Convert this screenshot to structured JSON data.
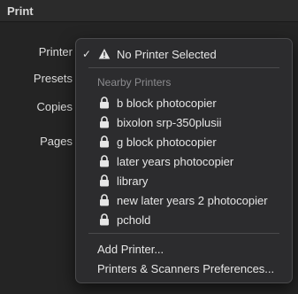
{
  "window": {
    "title": "Print"
  },
  "form": {
    "printer_label": "Printer",
    "presets_label": "Presets",
    "copies_label": "Copies",
    "pages_label": "Pages"
  },
  "menu": {
    "selected": {
      "label": "No Printer Selected",
      "checked": true,
      "icon": "warning-icon"
    },
    "nearby_header": "Nearby Printers",
    "printers": [
      {
        "label": "b block photocopier",
        "icon": "lock-icon"
      },
      {
        "label": "bixolon srp-350plusii",
        "icon": "lock-icon"
      },
      {
        "label": "g block photocopier",
        "icon": "lock-icon"
      },
      {
        "label": "later years photocopier",
        "icon": "lock-icon"
      },
      {
        "label": "library",
        "icon": "lock-icon"
      },
      {
        "label": "new later years 2 photocopier",
        "icon": "lock-icon"
      },
      {
        "label": "pchold",
        "icon": "lock-icon"
      }
    ],
    "actions": [
      {
        "label": "Add Printer..."
      },
      {
        "label": "Printers & Scanners Preferences..."
      }
    ]
  },
  "colors": {
    "menu_background": "#2c2c2e",
    "header_text": "#8b8b8e",
    "item_text": "#e6e6e6"
  }
}
